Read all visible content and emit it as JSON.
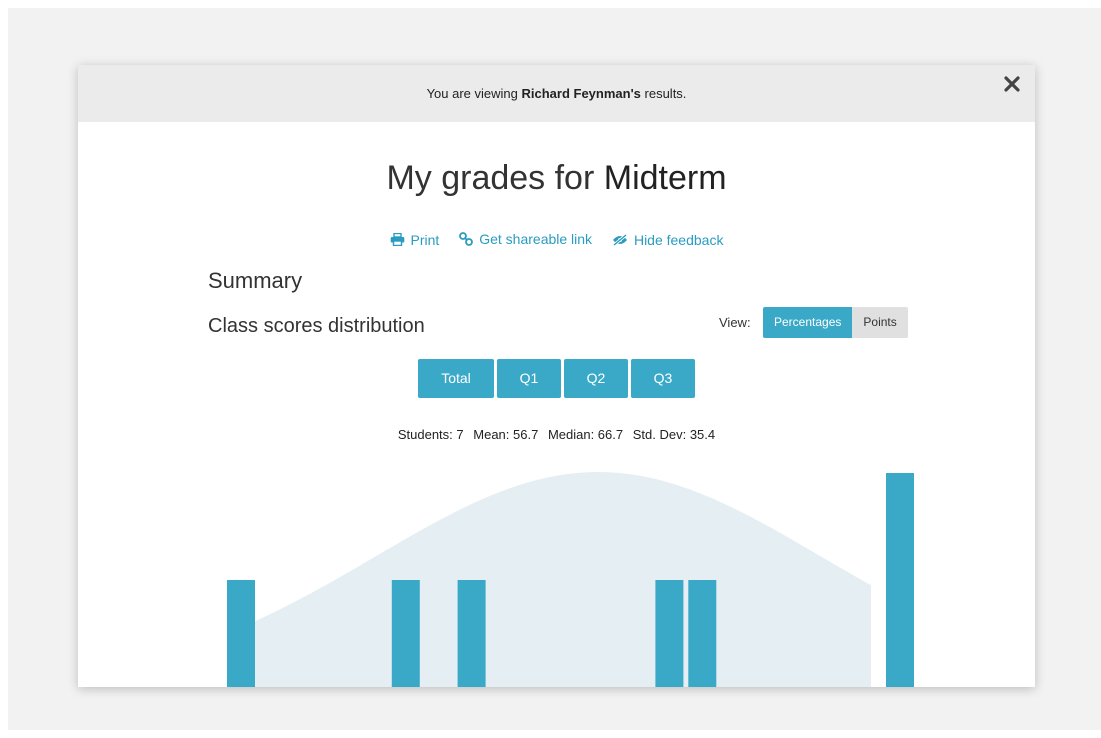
{
  "notice": {
    "prefix": "You are viewing ",
    "name": "Richard Feynman's",
    "suffix": " results."
  },
  "title": {
    "prefix": "My grades for ",
    "exam": "Midterm"
  },
  "actions": {
    "print": "Print",
    "share": "Get shareable link",
    "hide": "Hide feedback"
  },
  "summary_heading": "Summary",
  "distribution_heading": "Class scores distribution",
  "view": {
    "label": "View:",
    "percentages": "Percentages",
    "points": "Points",
    "selected": "Percentages"
  },
  "tabs": [
    "Total",
    "Q1",
    "Q2",
    "Q3"
  ],
  "stats": {
    "students": "Students: 7",
    "mean": "Mean: 56.7",
    "median": "Median: 66.7",
    "std": "Std. Dev: 35.4"
  },
  "colors": {
    "accent": "#3aa9c8",
    "curve": "#e5eff3"
  },
  "chart_data": {
    "type": "bar",
    "x": [
      0,
      25,
      35,
      65,
      70,
      100
    ],
    "values": [
      1,
      1,
      1,
      1,
      1,
      2
    ],
    "xlim": [
      0,
      100
    ],
    "ylim": [
      0,
      2
    ],
    "normal_curve": {
      "mean": 56.7,
      "std": 35.4
    }
  }
}
